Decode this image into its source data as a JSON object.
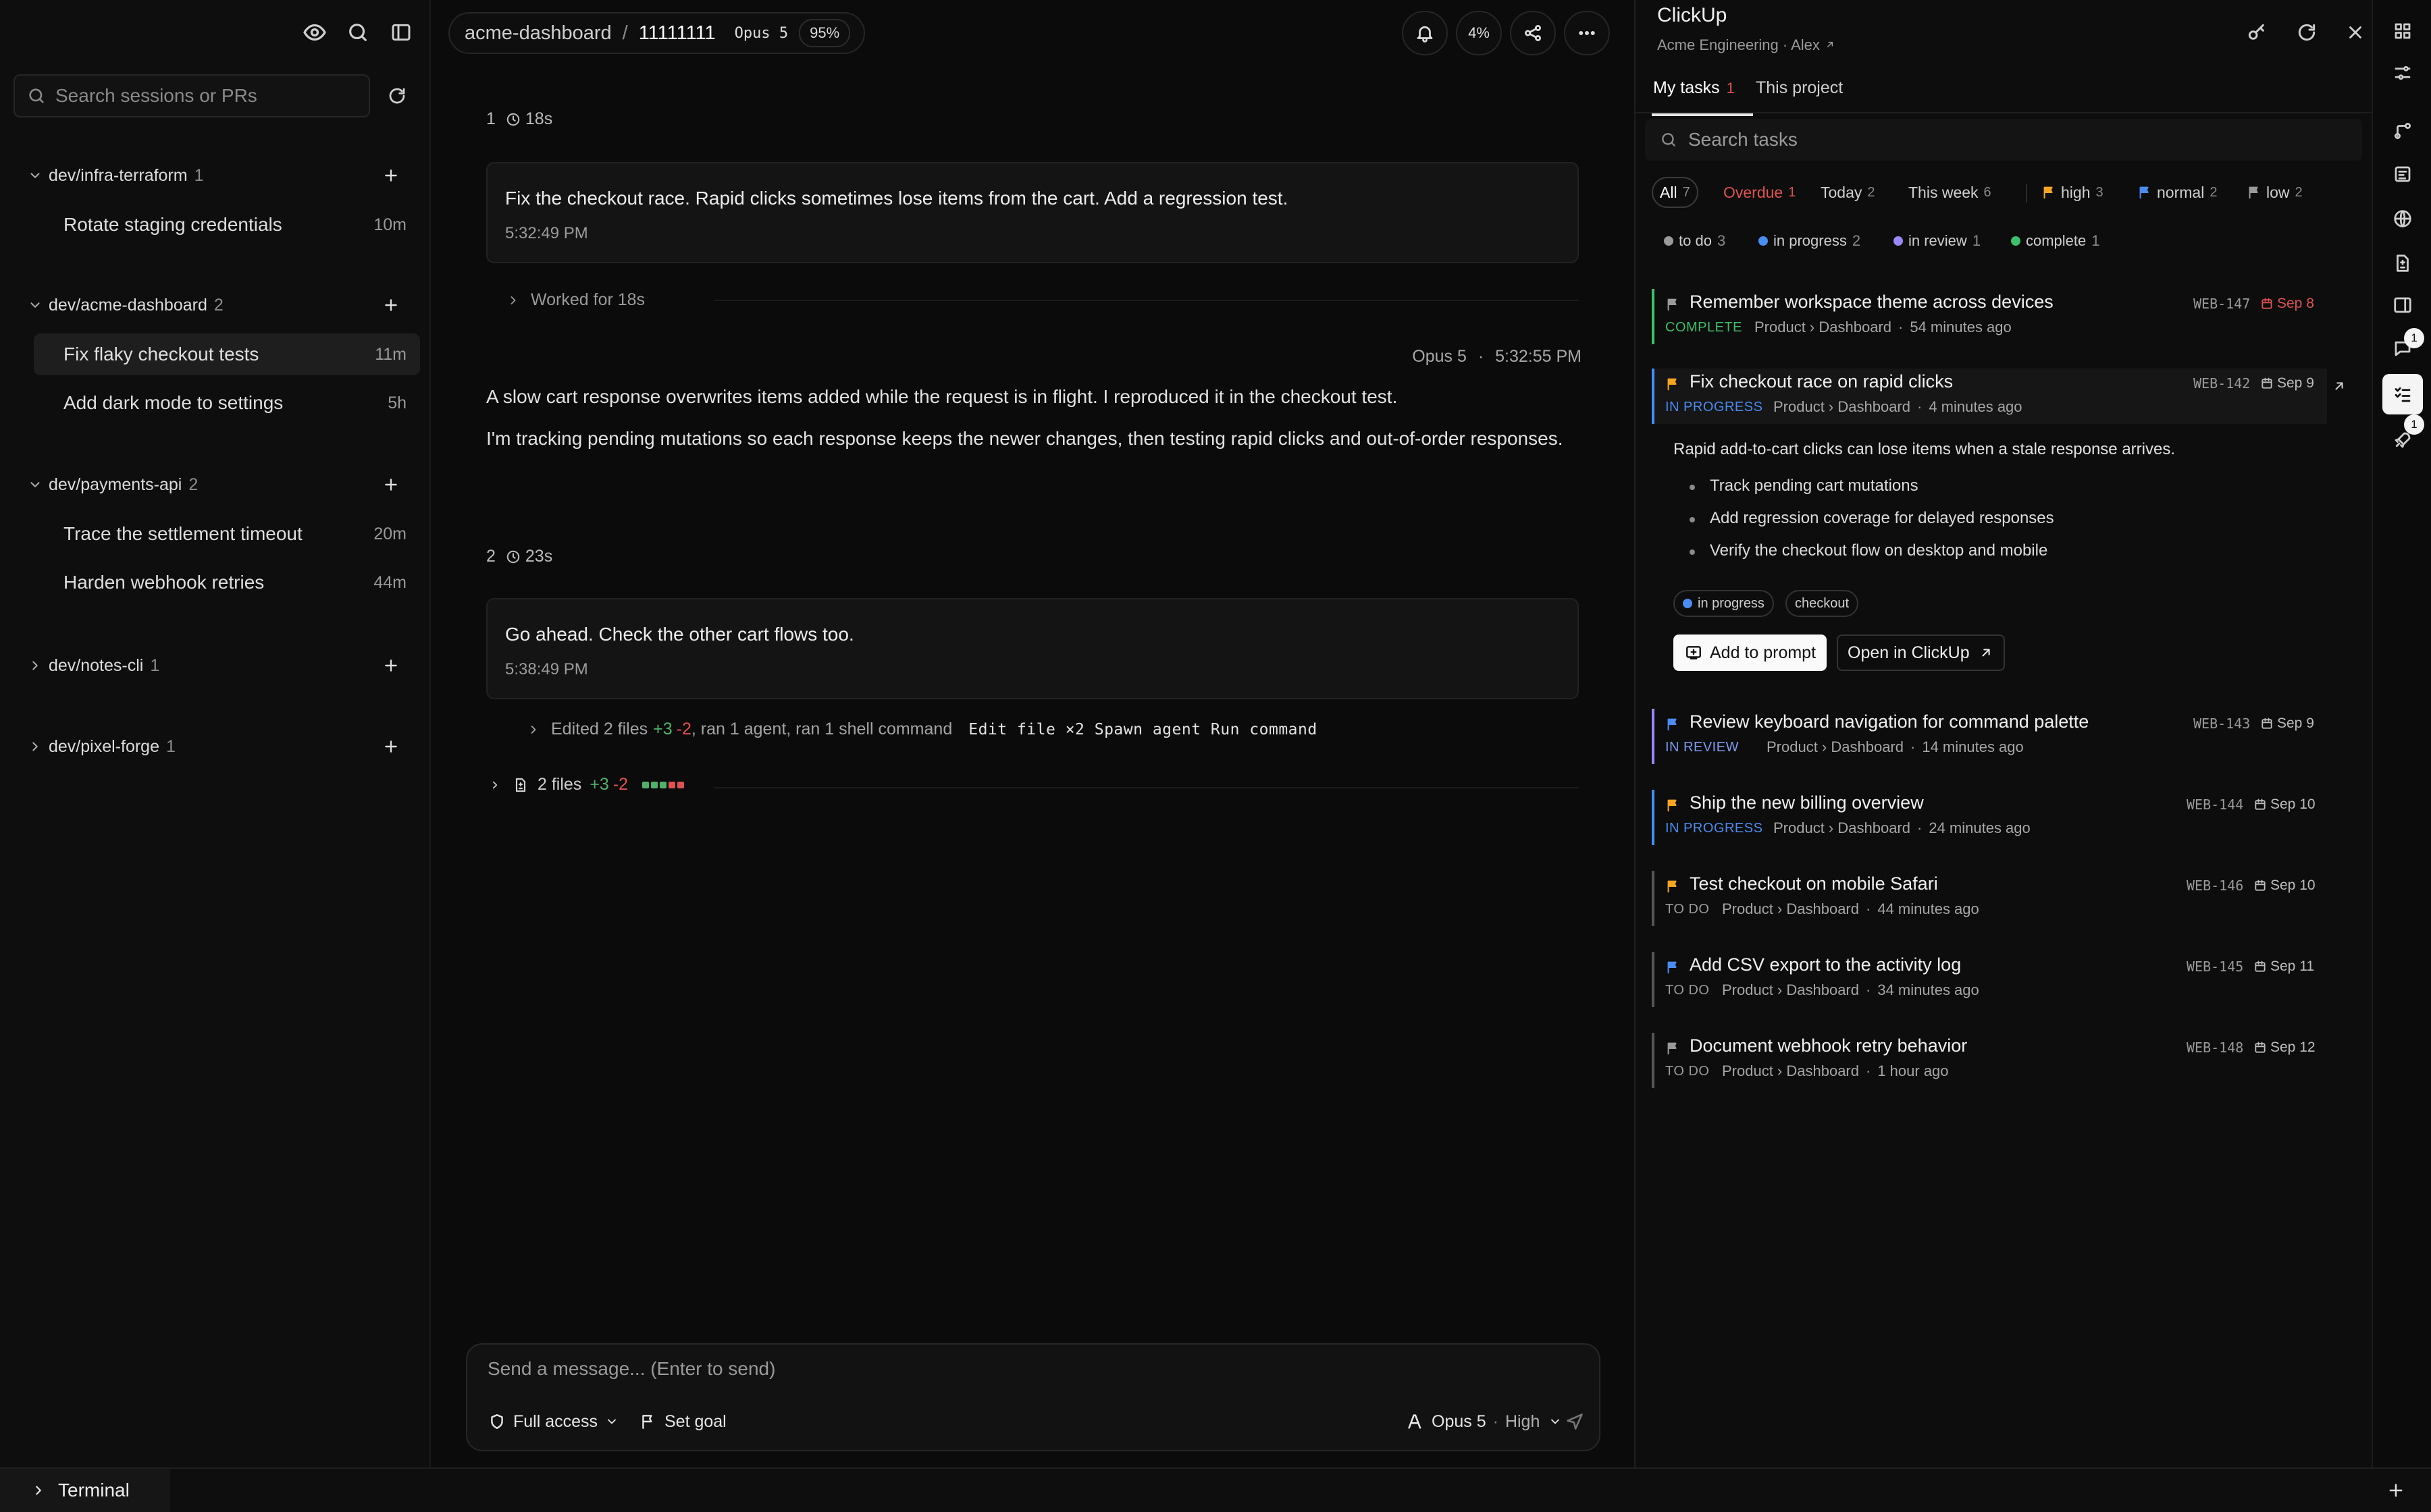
{
  "sidebar": {
    "search_placeholder": "Search sessions or PRs",
    "repos": [
      {
        "name": "dev/infra-terraform",
        "count": "1",
        "sessions": [
          {
            "title": "Rotate staging credentials",
            "time": "10m"
          }
        ]
      },
      {
        "name": "dev/acme-dashboard",
        "count": "2",
        "sessions": [
          {
            "title": "Fix flaky checkout tests",
            "time": "11m"
          },
          {
            "title": "Add dark mode to settings",
            "time": "5h"
          }
        ]
      },
      {
        "name": "dev/payments-api",
        "count": "2",
        "sessions": [
          {
            "title": "Trace the settlement timeout",
            "time": "20m"
          },
          {
            "title": "Harden webhook retries",
            "time": "44m"
          }
        ]
      },
      {
        "name": "dev/notes-cli",
        "count": "1"
      },
      {
        "name": "dev/pixel-forge",
        "count": "1"
      }
    ]
  },
  "header": {
    "repo": "acme-dashboard",
    "separator": "/",
    "session_id": "11111111",
    "model": "Opus 5",
    "context_pct": "95%",
    "usage_pct": "4%"
  },
  "conversation": {
    "turn1": {
      "index": "1",
      "duration": "18s",
      "user_message": "Fix the checkout race. Rapid clicks sometimes lose items from the cart. Add a regression test.",
      "user_time": "5:32:49 PM",
      "worked": "Worked for 18s",
      "ai_model": "Opus 5",
      "ai_dot": "·",
      "ai_time": "5:32:55 PM",
      "ai_para1": "A slow cart response overwrites items added while the request is in flight. I reproduced it in the checkout test.",
      "ai_para2": "I'm tracking pending mutations so each response keeps the newer changes, then testing rapid clicks and out-of-order responses."
    },
    "turn2": {
      "index": "2",
      "duration": "23s",
      "user_message": "Go ahead. Check the other cart flows too.",
      "user_time": "5:38:49 PM",
      "edited_prefix": "Edited 2 files",
      "edited_add": "+3",
      "edited_del": "-2",
      "edited_suffix": ", ran 1 agent, ran 1 shell command",
      "tools": "Edit file ×2  Spawn agent  Run command",
      "files_label": "2 files",
      "files_add": "+3",
      "files_del": "-2"
    }
  },
  "composer": {
    "placeholder": "Send a message... (Enter to send)",
    "access": "Full access",
    "goal": "Set goal",
    "model": "Opus 5",
    "dot": "·",
    "effort": "High"
  },
  "clickup": {
    "title": "ClickUp",
    "workspace": "Acme Engineering · Alex",
    "tabs": [
      {
        "label": "My tasks",
        "count": "1"
      },
      {
        "label": "This project"
      }
    ],
    "search_placeholder": "Search tasks",
    "filters": [
      {
        "label": "All",
        "count": "7"
      },
      {
        "label": "Overdue",
        "count": "1"
      },
      {
        "label": "Today",
        "count": "2"
      },
      {
        "label": "This week",
        "count": "6"
      },
      {
        "label": "high",
        "count": "3"
      },
      {
        "label": "normal",
        "count": "2"
      },
      {
        "label": "low",
        "count": "2"
      }
    ],
    "statuses": [
      {
        "label": "to do",
        "count": "3"
      },
      {
        "label": "in progress",
        "count": "2"
      },
      {
        "label": "in review",
        "count": "1"
      },
      {
        "label": "complete",
        "count": "1"
      }
    ],
    "tasks": [
      {
        "title": "Remember workspace theme across devices",
        "status": "COMPLETE",
        "path": "Product › Dashboard",
        "dot": "·",
        "age": "54 minutes ago",
        "id": "WEB-147",
        "due": "Sep 8"
      },
      {
        "title": "Fix checkout race on rapid clicks",
        "status": "IN PROGRESS",
        "path": "Product › Dashboard",
        "dot": "·",
        "age": "4 minutes ago",
        "id": "WEB-142",
        "due": "Sep 9"
      },
      {
        "title": "Review keyboard navigation for command palette",
        "status": "IN REVIEW",
        "path": "Product › Dashboard",
        "dot": "·",
        "age": "14 minutes ago",
        "id": "WEB-143",
        "due": "Sep 9"
      },
      {
        "title": "Ship the new billing overview",
        "status": "IN PROGRESS",
        "path": "Product › Dashboard",
        "dot": "·",
        "age": "24 minutes ago",
        "id": "WEB-144",
        "due": "Sep 10"
      },
      {
        "title": "Test checkout on mobile Safari",
        "status": "TO DO",
        "path": "Product › Dashboard",
        "dot": "·",
        "age": "44 minutes ago",
        "id": "WEB-146",
        "due": "Sep 10"
      },
      {
        "title": "Add CSV export to the activity log",
        "status": "TO DO",
        "path": "Product › Dashboard",
        "dot": "·",
        "age": "34 minutes ago",
        "id": "WEB-145",
        "due": "Sep 11"
      },
      {
        "title": "Document webhook retry behavior",
        "status": "TO DO",
        "path": "Product › Dashboard",
        "dot": "·",
        "age": "1 hour ago",
        "id": "WEB-148",
        "due": "Sep 12"
      }
    ],
    "detail": {
      "description": "Rapid add-to-cart clicks can lose items when a stale response arrives.",
      "bullets": [
        "Track pending cart mutations",
        "Add regression coverage for delayed responses",
        "Verify the checkout flow on desktop and mobile"
      ],
      "tags": [
        "in progress",
        "checkout"
      ],
      "add_to_prompt": "Add to prompt",
      "open_in": "Open in ClickUp"
    }
  },
  "rail": {
    "badges": [
      "1",
      "1"
    ]
  },
  "bottom": {
    "terminal": "Terminal"
  },
  "colors": {
    "accent_green": "#4fb26b",
    "accent_red": "#e05252",
    "in_progress": "#4a8cf0",
    "in_review": "#9b87f5",
    "complete": "#3fbf6a",
    "flag_high": "#f5a524",
    "flag_normal": "#4a8cf0",
    "flag_low": "#9a9a9a"
  }
}
